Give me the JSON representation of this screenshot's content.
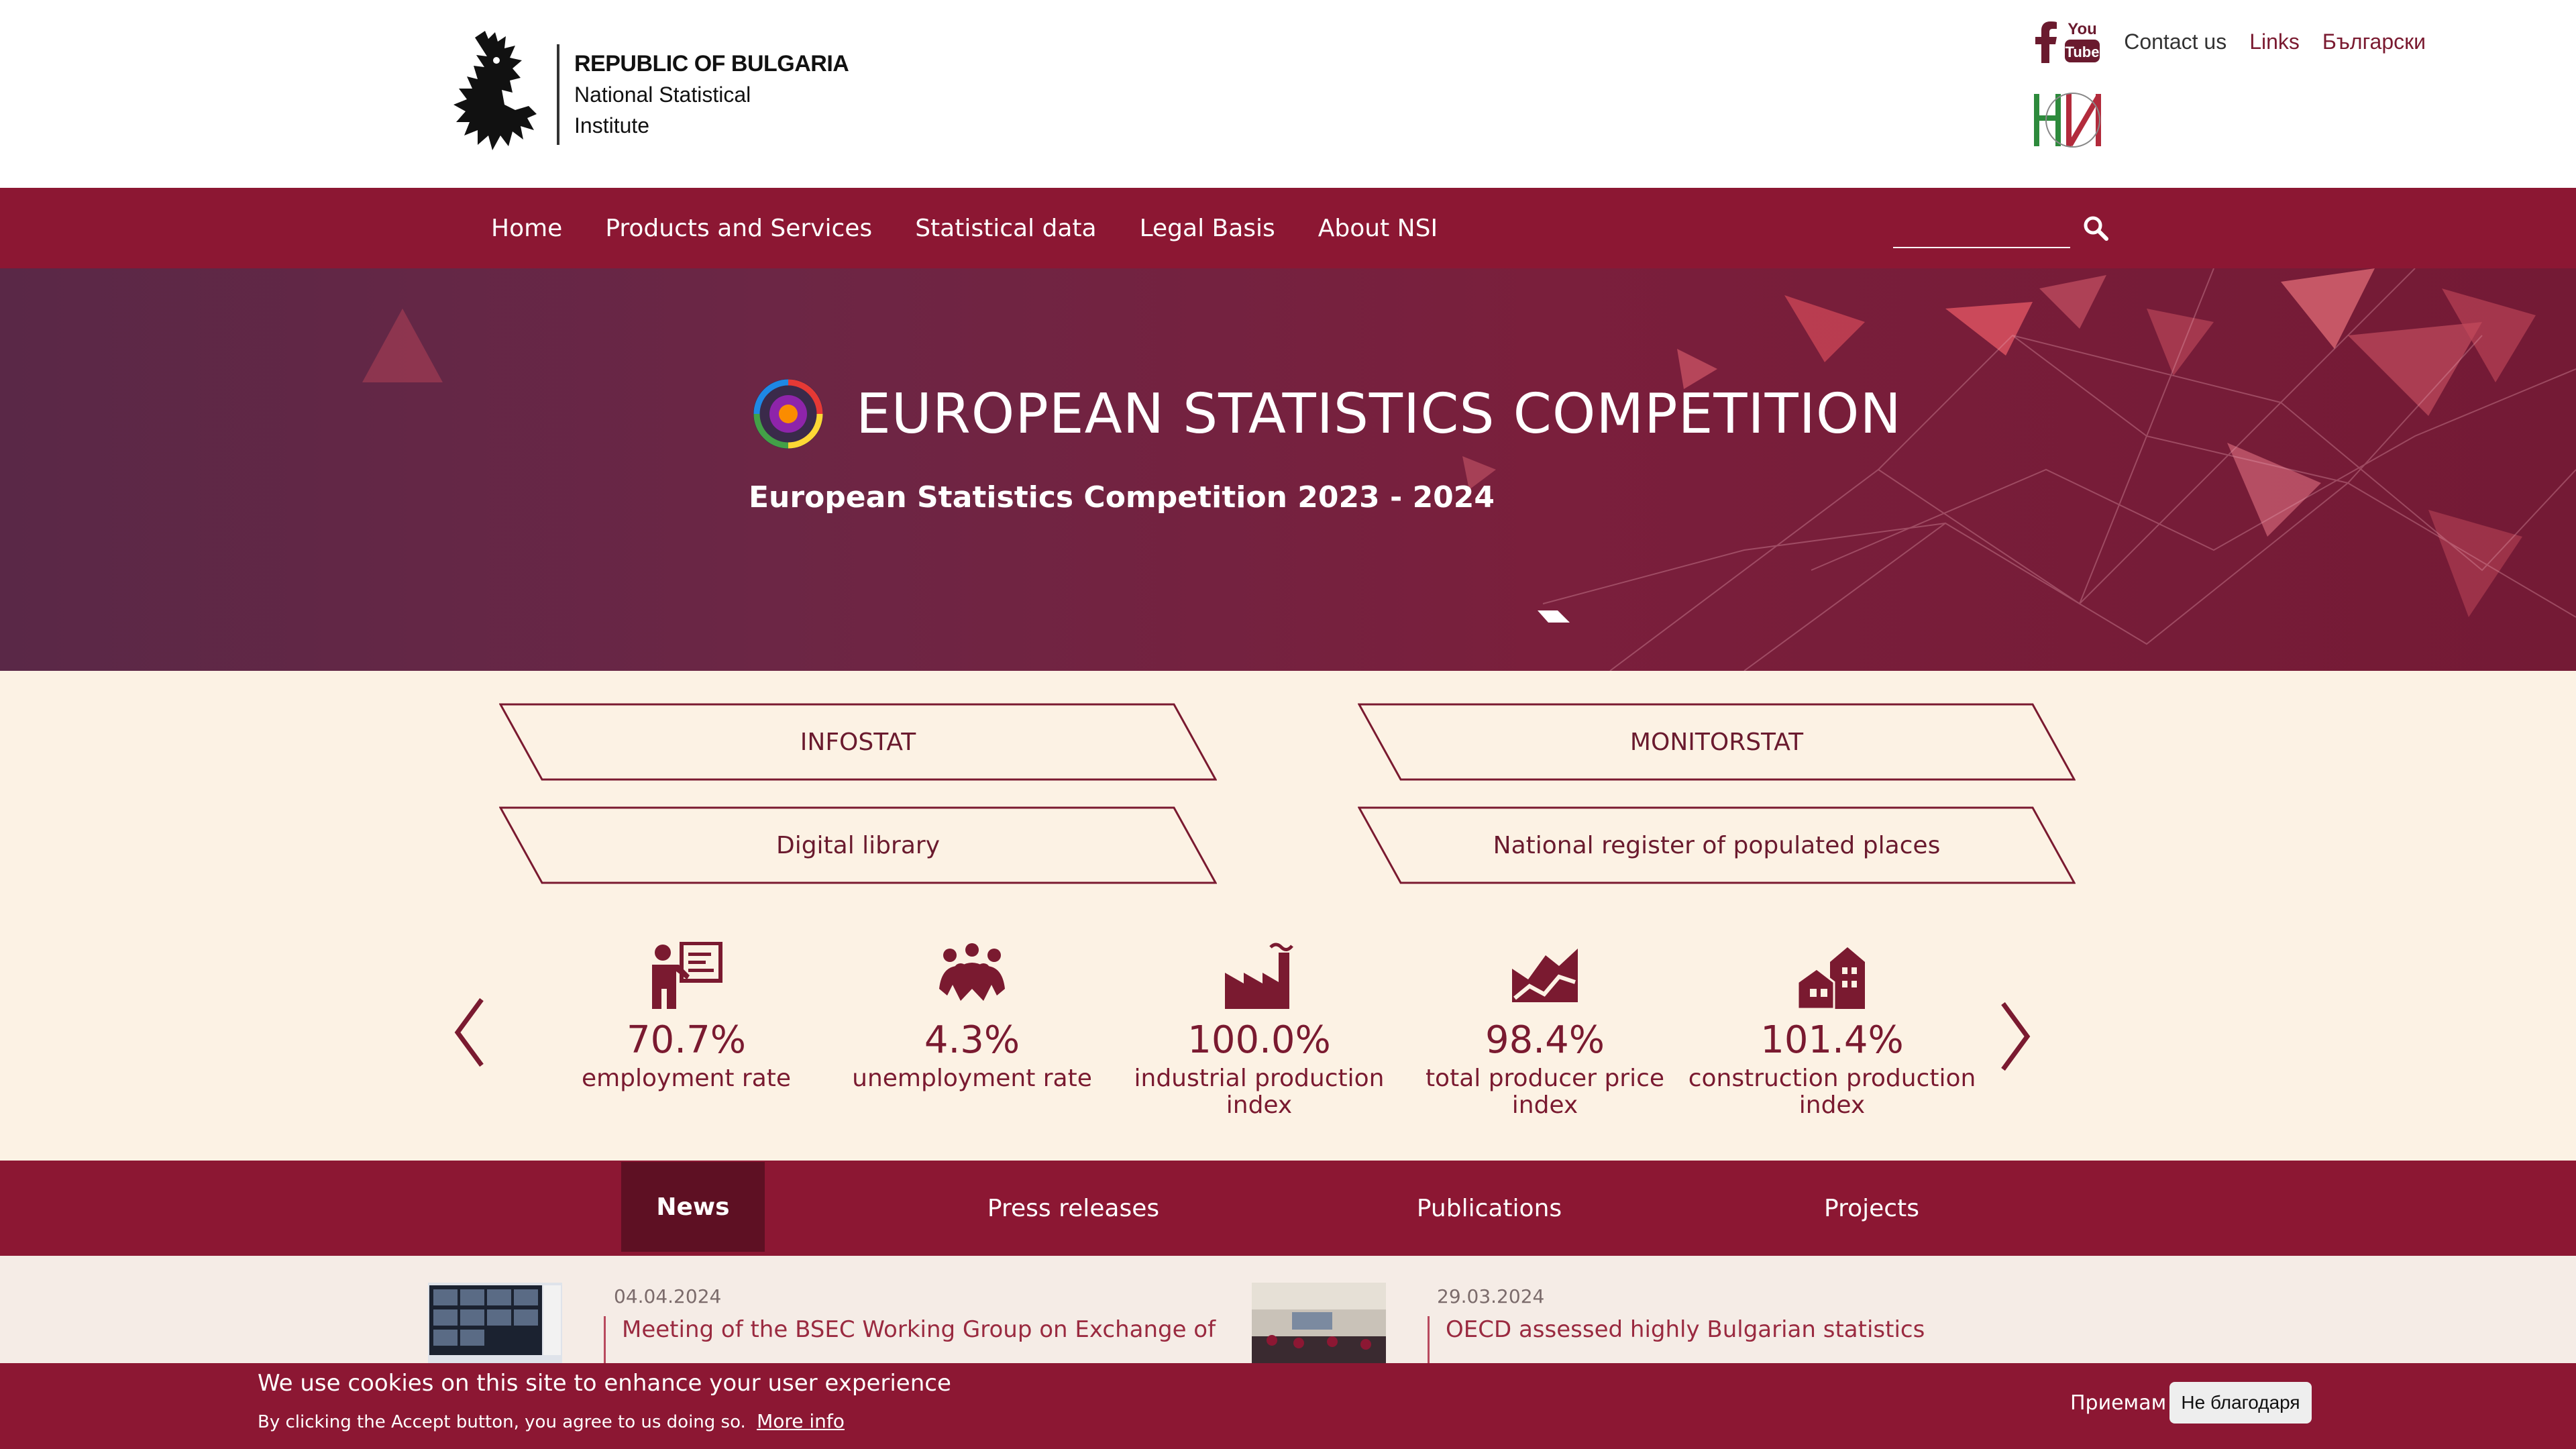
{
  "header": {
    "logo_line1": "REPUBLIC OF BULGARIA",
    "logo_line2": "National Statistical",
    "logo_line3": "Institute",
    "links": {
      "contact": "Contact us",
      "links": "Links",
      "language": "Български"
    },
    "youtube_you": "You",
    "youtube_tube": "Tube"
  },
  "nav": {
    "items": [
      {
        "label": "Home"
      },
      {
        "label": "Products and Services"
      },
      {
        "label": "Statistical data"
      },
      {
        "label": "Legal Basis"
      },
      {
        "label": "About NSI"
      }
    ],
    "search_placeholder": ""
  },
  "hero": {
    "title": "EUROPEAN STATISTICS COMPETITION",
    "subtitle": "European Statistics Competition 2023 - 2024"
  },
  "quick_links": [
    {
      "label": "INFOSTAT"
    },
    {
      "label": "MONITORSTAT"
    },
    {
      "label": "Digital library"
    },
    {
      "label": "National register of populated places"
    }
  ],
  "indicators": [
    {
      "value": "70.7%",
      "label": "employment rate",
      "icon": "presenter-icon"
    },
    {
      "value": "4.3%",
      "label": "unemployment rate",
      "icon": "group-icon"
    },
    {
      "value": "100.0%",
      "label": "industrial production index",
      "icon": "factory-icon"
    },
    {
      "value": "98.4%",
      "label": "total producer price index",
      "icon": "area-chart-icon"
    },
    {
      "value": "101.4%",
      "label": "construction production index",
      "icon": "buildings-icon"
    }
  ],
  "tabs": [
    {
      "label": "News",
      "active": true
    },
    {
      "label": "Press releases"
    },
    {
      "label": "Publications"
    },
    {
      "label": "Projects"
    }
  ],
  "news": [
    {
      "date": "04.04.2024",
      "title": "Meeting of the BSEC Working Group on Exchange of"
    },
    {
      "date": "29.03.2024",
      "title": "OECD assessed highly Bulgarian statistics"
    }
  ],
  "cookie": {
    "main": "We use cookies on this site to enhance your user experience",
    "sub": "By clicking the Accept button, you agree to us doing so.",
    "more": "More info",
    "accept": "Приемам",
    "decline": "Не благодаря"
  },
  "colors": {
    "brand": "#8c1733",
    "brand_dark": "#5e1023",
    "cream": "#fcf2e4"
  }
}
